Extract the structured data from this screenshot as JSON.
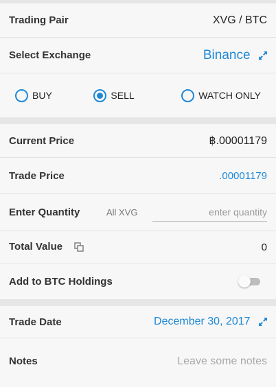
{
  "trading_pair": {
    "label": "Trading Pair",
    "value": "XVG / BTC"
  },
  "exchange": {
    "label": "Select Exchange",
    "value": "Binance",
    "icon": "expand-icon"
  },
  "order_type": {
    "options": [
      {
        "label": "BUY",
        "selected": false
      },
      {
        "label": "SELL",
        "selected": true
      },
      {
        "label": "WATCH ONLY",
        "selected": false
      }
    ]
  },
  "current_price": {
    "label": "Current Price",
    "value": "฿.00001179"
  },
  "trade_price": {
    "label": "Trade Price",
    "value": ".00001179"
  },
  "quantity": {
    "label": "Enter Quantity",
    "hint": "All XVG",
    "placeholder": "enter quantity",
    "value": ""
  },
  "total_value": {
    "label": "Total Value",
    "value": "0",
    "icon": "copy-icon"
  },
  "btc_holdings": {
    "label": "Add to BTC Holdings",
    "enabled": false
  },
  "trade_date": {
    "label": "Trade Date",
    "value": "December 30, 2017",
    "icon": "expand-icon"
  },
  "notes": {
    "label": "Notes",
    "placeholder": "Leave some notes"
  },
  "colors": {
    "accent": "#1e88d6",
    "background": "#f7f7f7",
    "band": "#e6e6e6"
  }
}
